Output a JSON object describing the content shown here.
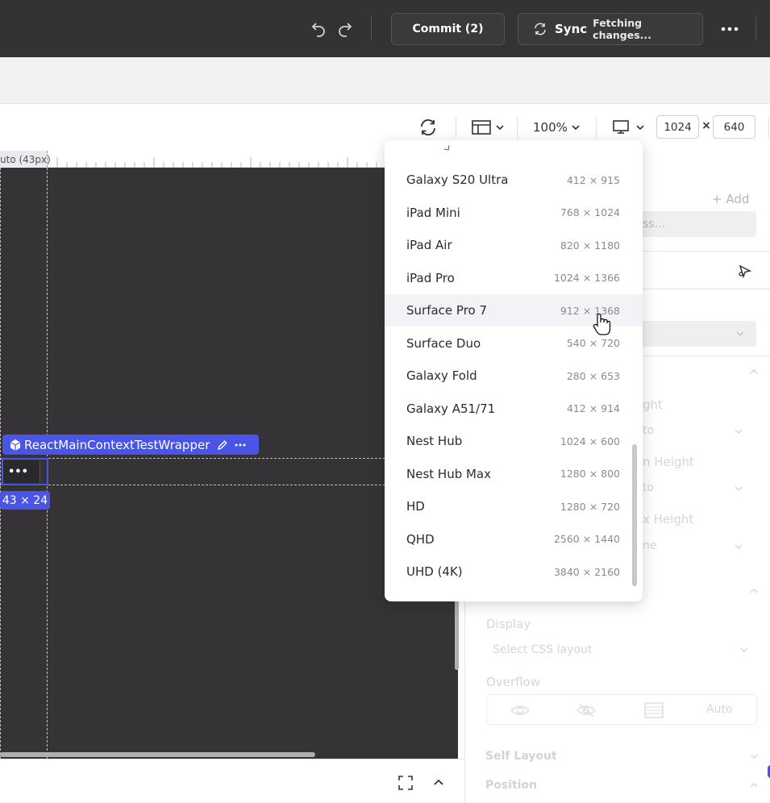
{
  "topbar": {
    "undo_icon": "undo-icon",
    "redo_icon": "redo-icon",
    "commit_label": "Commit (2)",
    "sync_label": "Sync",
    "sync_status": "Fetching changes...",
    "more_icon": "more-horizontal-icon"
  },
  "toolbar": {
    "refresh_icon": "refresh-icon",
    "layout_icon": "layout-icon",
    "zoom_label": "100%",
    "device_icon": "monitor-icon",
    "width_value": "1024",
    "times_symbol": "×",
    "height_value": "640"
  },
  "canvas": {
    "ruler_label": "uto (43px)",
    "component_label": "ReactMainContextTestWrapper",
    "element_more": "•••",
    "size_badge": "43 × 24"
  },
  "panel": {
    "add_label": "+ Add",
    "search_placeholder_fragment": "ss...",
    "height_fragment": "ght",
    "height_value_fragment": "to",
    "min_height_fragment": "n Height",
    "min_height_value_fragment": "to",
    "max_height_fragment": "x Height",
    "max_height_value_fragment": "ne",
    "display_label": "Display",
    "display_placeholder": "Select CSS layout",
    "overflow_label": "Overflow",
    "overflow_auto": "Auto",
    "self_layout_label": "Self Layout",
    "position_label": "Position"
  },
  "dropdown": {
    "items": [
      {
        "name": "Galaxy S20 Ultra",
        "size": "412 × 915"
      },
      {
        "name": "iPad Mini",
        "size": "768 × 1024"
      },
      {
        "name": "iPad Air",
        "size": "820 × 1180"
      },
      {
        "name": "iPad Pro",
        "size": "1024 × 1366"
      },
      {
        "name": "Surface Pro 7",
        "size": "912 × 1368"
      },
      {
        "name": "Surface Duo",
        "size": "540 × 720"
      },
      {
        "name": "Galaxy Fold",
        "size": "280 × 653"
      },
      {
        "name": "Galaxy A51/71",
        "size": "412 × 914"
      },
      {
        "name": "Nest Hub",
        "size": "1024 × 600"
      },
      {
        "name": "Nest Hub Max",
        "size": "1280 × 800"
      },
      {
        "name": "HD",
        "size": "1280 × 720"
      },
      {
        "name": "QHD",
        "size": "2560 × 1440"
      },
      {
        "name": "UHD (4K)",
        "size": "3840 × 2160"
      }
    ],
    "highlighted_index": 4
  },
  "bottombar": {
    "fullscreen_icon": "fullscreen-icon",
    "collapse_icon": "chevron-up-icon"
  },
  "colors": {
    "topbar_bg": "#333234",
    "canvas_bg": "#353336",
    "accent": "#4a55e8",
    "highlight": "#f2f3f7"
  }
}
